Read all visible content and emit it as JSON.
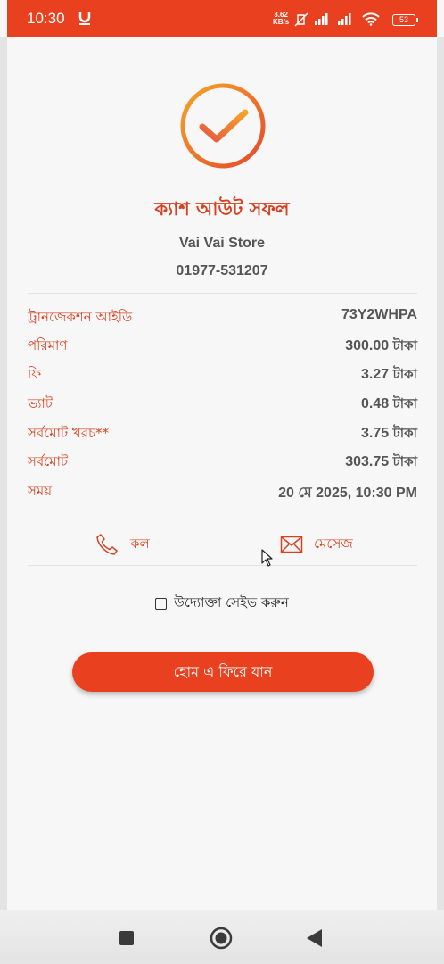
{
  "status_bar": {
    "time": "10:30",
    "speed_value": "3.62",
    "speed_unit": "KB/s",
    "battery": "53"
  },
  "receipt": {
    "title": "ক্যাশ আউট সফল",
    "store_name": "Vai Vai Store",
    "phone": "01977-531207",
    "rows": [
      {
        "label": "ট্রানজেকশন আইডি",
        "value": "73Y2WHPA",
        "unit": ""
      },
      {
        "label": "পরিমাণ",
        "value": "300.00",
        "unit": "টাকা"
      },
      {
        "label": "ফি",
        "value": "3.27",
        "unit": "টাকা"
      },
      {
        "label": "ভ্যাট",
        "value": "0.48",
        "unit": "টাকা"
      },
      {
        "label": "সর্বমোট খরচ**",
        "value": "3.75",
        "unit": "টাকা"
      },
      {
        "label": "সর্বমোট",
        "value": "303.75",
        "unit": "টাকা"
      },
      {
        "label": "সময়",
        "value": "20 মে 2025, 10:30 PM",
        "unit": ""
      }
    ]
  },
  "actions": {
    "call_label": "কল",
    "message_label": "মেসেজ"
  },
  "save_entrepreneur": {
    "label": "উদ্যোক্তা সেইভ করুন",
    "checked": false
  },
  "home_button": {
    "label": "হোম এ ফিরে যান"
  },
  "colors": {
    "accent": "#e9401f",
    "label_red": "#d6411f",
    "success_ring_start": "#f4a52a",
    "success_ring_end": "#e8472a"
  },
  "icons": {
    "success": "check-circle-icon",
    "call": "phone-icon",
    "message": "envelope-icon",
    "nav_recent": "square-icon",
    "nav_home": "circle-icon",
    "nav_back": "triangle-back-icon"
  }
}
